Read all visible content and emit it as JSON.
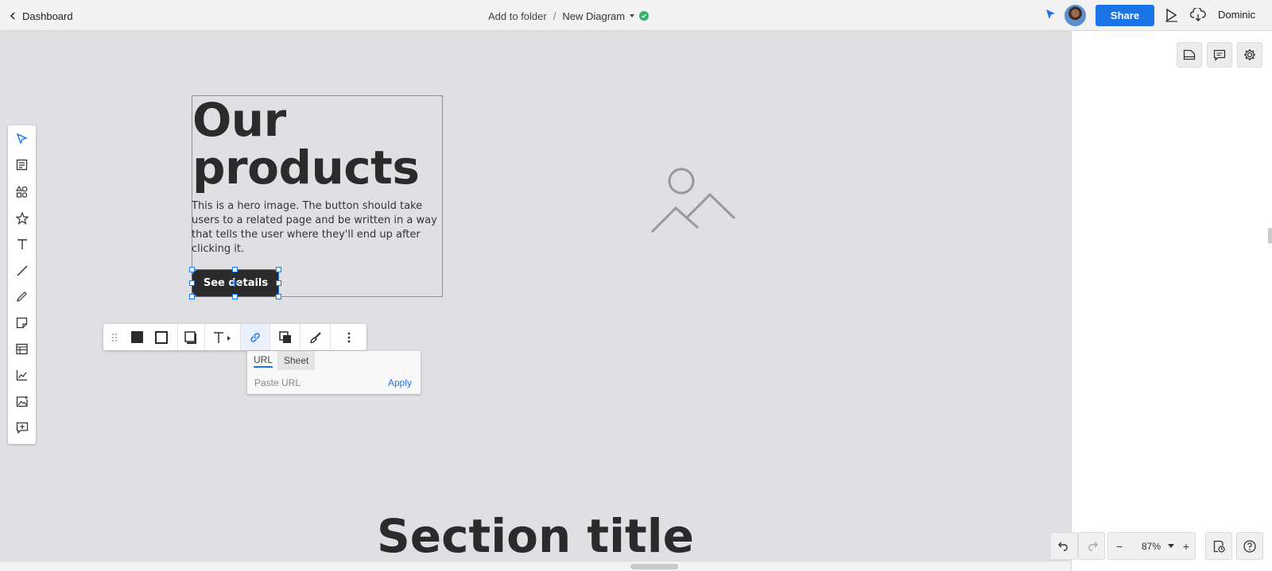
{
  "topbar": {
    "back_label": "Dashboard",
    "folder_label": "Add to folder",
    "separator": "/",
    "doc_title": "New Diagram",
    "share_label": "Share",
    "user_name": "Dominic",
    "status_color": "#2fb36b",
    "accent_color": "#1b73e8"
  },
  "left_toolbar": {
    "tools": [
      "select-tool",
      "templates-tool",
      "shapes-tool",
      "icons-tool",
      "text-tool",
      "line-tool",
      "pen-tool",
      "sticky-note-tool",
      "table-tool",
      "chart-tool",
      "image-tool",
      "embed-tool"
    ]
  },
  "canvas": {
    "hero_title": "Our\nproducts",
    "hero_desc": "This is a hero image. The button should take users to a related page and be written in a way that tells the user where they'll end up after clicking it.",
    "button_label": "See details",
    "section_title": "Section title"
  },
  "link_popup": {
    "tab_url": "URL",
    "tab_sheet": "Sheet",
    "placeholder": "Paste URL",
    "apply_label": "Apply"
  },
  "zoom": {
    "minus": "−",
    "value": "87%",
    "plus": "+"
  }
}
